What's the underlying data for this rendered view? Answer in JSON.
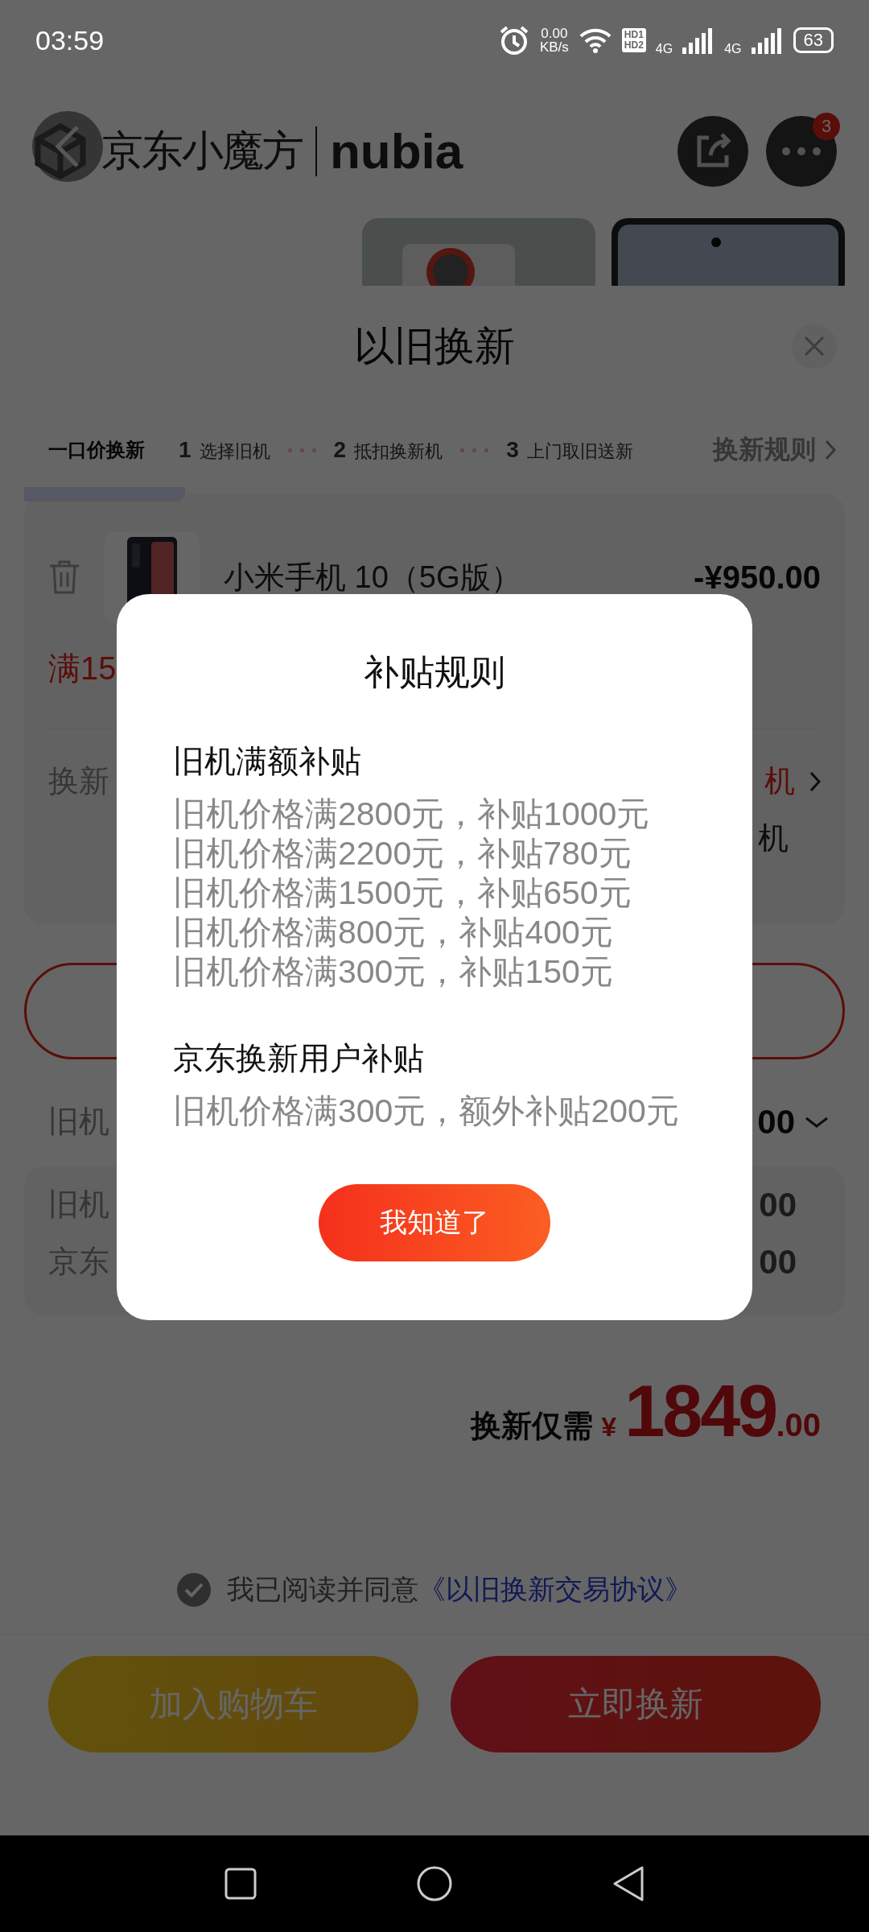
{
  "status_bar": {
    "time": "03:59",
    "net_speed": "0.00",
    "net_unit": "KB/s",
    "hd": [
      "HD1",
      "HD2"
    ],
    "networks": [
      "4G",
      "4G"
    ],
    "battery": "63"
  },
  "header": {
    "brand": "京东小魔方",
    "partner": "nubia",
    "badge": "3"
  },
  "sheet": {
    "title": "以旧换新",
    "steps_label": "一口价换新",
    "steps": [
      {
        "number": "1",
        "label": "选择旧机"
      },
      {
        "number": "2",
        "label": "抵扣换新机"
      },
      {
        "number": "3",
        "label": "上门取旧送新"
      }
    ],
    "rules_link": "换新规则"
  },
  "old_device": {
    "name": "小米手机 10（5G版）",
    "price": "-¥950.00",
    "threshold": "满15",
    "option_label": "换新",
    "option_value": "机",
    "option_note": "机"
  },
  "valuation": {
    "label": "旧机",
    "value": "00",
    "rows": [
      {
        "label": "旧机",
        "value": "00"
      },
      {
        "label": "京东",
        "value": "00"
      }
    ]
  },
  "total": {
    "label": "换新仅需",
    "currency": "¥",
    "integer": "1849",
    "decimal": ".00"
  },
  "agreement": {
    "checked": true,
    "text": "我已阅读并同意",
    "link": "《以旧换新交易协议》"
  },
  "buttons": [
    {
      "label": "加入购物车",
      "kind": "cart"
    },
    {
      "label": "立即换新",
      "kind": "trade"
    }
  ],
  "dialog": {
    "title": "补贴规则",
    "sections": [
      {
        "heading": "旧机满额补贴",
        "lines": [
          "旧机价格满2800元，补贴1000元",
          "旧机价格满2200元，补贴780元",
          "旧机价格满1500元，补贴650元",
          "旧机价格满800元，补贴400元",
          "旧机价格满300元，补贴150元"
        ]
      },
      {
        "heading": "京东换新用户补贴",
        "lines": [
          "旧机价格满300元，额外补贴200元"
        ]
      }
    ],
    "confirm": "我知道了"
  }
}
